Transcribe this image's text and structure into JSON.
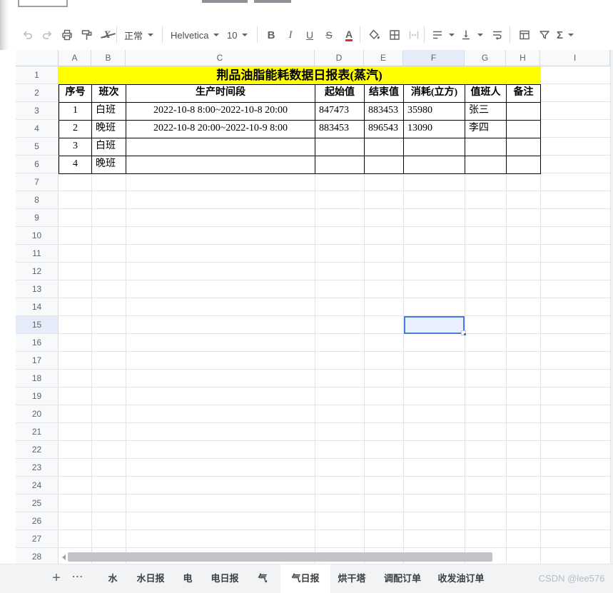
{
  "toolbar": {
    "style_value": "正常",
    "font_value": "Helvetica",
    "size_value": "10",
    "bold": "B",
    "italic": "I",
    "underline": "U",
    "strike": "S",
    "text_color": "A",
    "sigma": "Σ"
  },
  "grid": {
    "column_headers": [
      "A",
      "B",
      "C",
      "D",
      "E",
      "F",
      "G",
      "H",
      "I"
    ],
    "row_count": 28,
    "selection": {
      "column": "F",
      "row": 15
    }
  },
  "table": {
    "title": "荆品油脂能耗数据日报表(蒸汽)",
    "headers": [
      "序号",
      "班次",
      "生产时间段",
      "起始值",
      "结束值",
      "消耗(立方)",
      "值班人",
      "备注"
    ],
    "rows": [
      [
        "1",
        "白班",
        "2022-10-8 8:00~2022-10-8 20:00",
        "847473",
        "883453",
        "35980",
        "张三",
        ""
      ],
      [
        "2",
        "晚班",
        "2022-10-8 20:00~2022-10-9 8:00",
        "883453",
        "896543",
        "13090",
        "李四",
        ""
      ],
      [
        "3",
        "白班",
        "",
        "",
        "",
        "",
        "",
        ""
      ],
      [
        "4",
        "晚班",
        "",
        "",
        "",
        "",
        "",
        ""
      ]
    ]
  },
  "footer": {
    "add_label": "+",
    "more_label": "⋯",
    "tabs": [
      "水",
      "水日报",
      "电",
      "电日报",
      "气",
      "气日报",
      "烘干塔",
      "调配订单",
      "收发油订单"
    ],
    "active_tab": "气日报",
    "watermark": "CSDN @lee576"
  }
}
